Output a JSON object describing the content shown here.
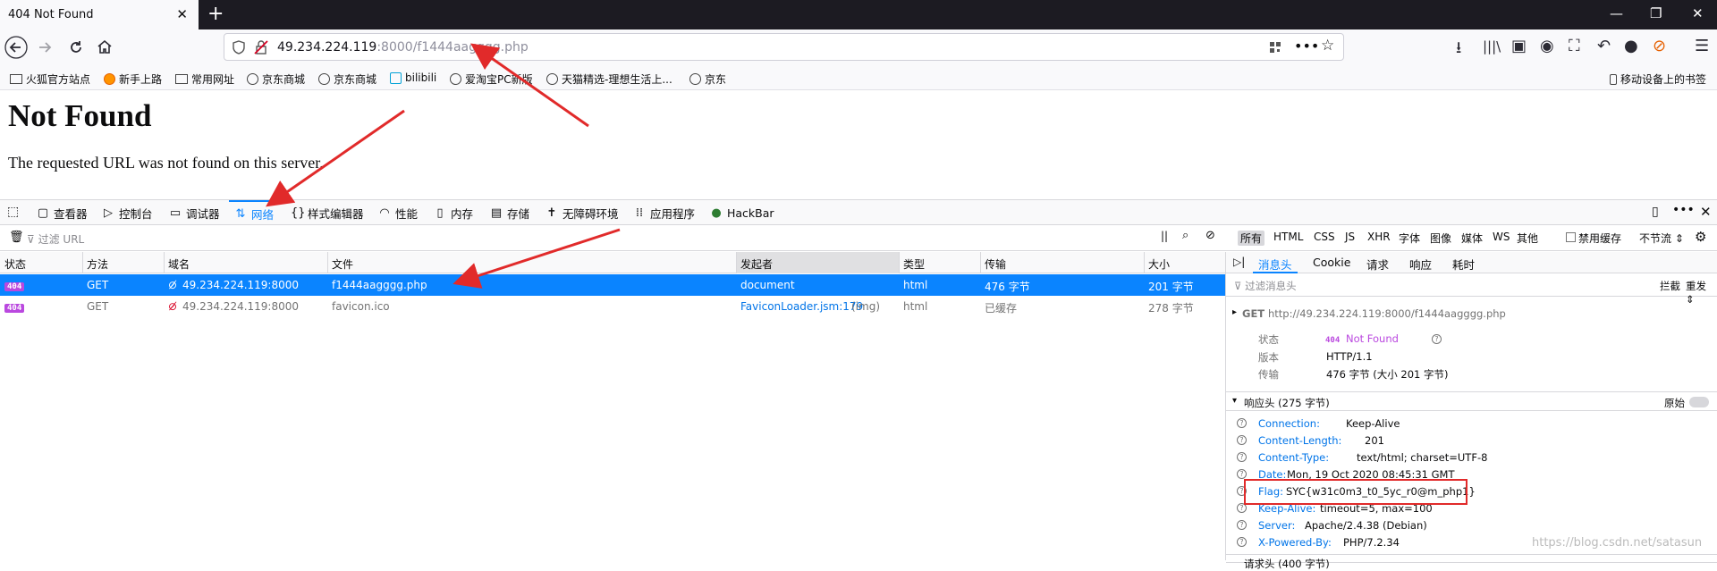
{
  "tab": {
    "title": "404 Not Found",
    "close": "✕",
    "new": "+"
  },
  "url": {
    "host": "49.234.224.119",
    "rest": ":8000/f1444aagggg.php"
  },
  "bookmarks": [
    {
      "label": "火狐官方站点",
      "icon": "folder-icon"
    },
    {
      "label": "新手上路",
      "icon": "firefox-icon"
    },
    {
      "label": "常用网址",
      "icon": "folder-icon"
    },
    {
      "label": "京东商城",
      "icon": "globe-icon"
    },
    {
      "label": "京东商城",
      "icon": "globe-icon"
    },
    {
      "label": "bilibili",
      "icon": "bilibili-icon"
    },
    {
      "label": "爱淘宝PC新版",
      "icon": "globe-icon"
    },
    {
      "label": "天猫精选-理想生活上...",
      "icon": "globe-icon"
    },
    {
      "label": "京东",
      "icon": "globe-icon"
    }
  ],
  "mobile_bookmarks": "移动设备上的书签",
  "page": {
    "title": "Not Found",
    "message": "The requested URL was not found on this server."
  },
  "devtools": {
    "tabs": [
      {
        "label": "查看器",
        "icon": "inspector-icon"
      },
      {
        "label": "控制台",
        "icon": "console-icon"
      },
      {
        "label": "调试器",
        "icon": "debugger-icon"
      },
      {
        "label": "网络",
        "icon": "network-icon"
      },
      {
        "label": "样式编辑器",
        "icon": "style-editor-icon"
      },
      {
        "label": "性能",
        "icon": "performance-icon"
      },
      {
        "label": "内存",
        "icon": "memory-icon"
      },
      {
        "label": "存储",
        "icon": "storage-icon"
      },
      {
        "label": "无障碍环境",
        "icon": "accessibility-icon"
      },
      {
        "label": "应用程序",
        "icon": "application-icon"
      },
      {
        "label": "HackBar",
        "icon": "hackbar-icon"
      }
    ],
    "active_tab": "网络"
  },
  "network": {
    "filter_placeholder": "过滤 URL",
    "types": [
      "所有",
      "HTML",
      "CSS",
      "JS",
      "XHR",
      "字体",
      "图像",
      "媒体",
      "WS",
      "其他"
    ],
    "disable_cache": "禁用缓存",
    "throttle": "不节流 ⇕",
    "columns": [
      "状态",
      "方法",
      "域名",
      "文件",
      "发起者",
      "类型",
      "传输",
      "大小"
    ],
    "rows": [
      {
        "status": "404",
        "method": "GET",
        "domain": "49.234.224.119:8000",
        "file": "f1444aagggg.php",
        "initiator": "document",
        "initiator_extra": "",
        "type": "html",
        "transfer": "476 字节",
        "size": "201 字节"
      },
      {
        "status": "404",
        "method": "GET",
        "domain": "49.234.224.119:8000",
        "file": "favicon.ico",
        "initiator": "FaviconLoader.jsm:179",
        "initiator_extra": "(img)",
        "type": "html",
        "transfer": "已缓存",
        "size": "278 字节"
      }
    ]
  },
  "details": {
    "tabs": [
      "消息头",
      "Cookie",
      "请求",
      "响应",
      "耗时"
    ],
    "filter_placeholder": "过滤消息头",
    "block": "拦截",
    "resend": "重发 ⇕",
    "request_line": "GET",
    "request_url": "http://49.234.224.119:8000/f1444aagggg.php",
    "summary": [
      {
        "key": "状态",
        "value": "Not Found",
        "badge": "404"
      },
      {
        "key": "版本",
        "value": "HTTP/1.1"
      },
      {
        "key": "传输",
        "value": "476 字节 (大小 201 字节)"
      }
    ],
    "response_section": "响应头 (275 字节)",
    "raw": "原始",
    "response_headers": [
      {
        "name": "Connection:",
        "value": "Keep-Alive"
      },
      {
        "name": "Content-Length:",
        "value": "201"
      },
      {
        "name": "Content-Type:",
        "value": "text/html; charset=UTF-8"
      },
      {
        "name": "Date:",
        "value": "Mon, 19 Oct 2020 08:45:31 GMT"
      },
      {
        "name": "Flag:",
        "value": "SYC{w31c0m3_t0_5yc_r0@m_php1}"
      },
      {
        "name": "Keep-Alive:",
        "value": "timeout=5, max=100"
      },
      {
        "name": "Server:",
        "value": "Apache/2.4.38 (Debian)"
      },
      {
        "name": "X-Powered-By:",
        "value": "PHP/7.2.34"
      }
    ],
    "request_section": "请求头 (400 字节)"
  },
  "watermark": "https://blog.csdn.net/satasun",
  "colors": {
    "accent": "#0a84ff",
    "selected_row": "#0a84ff",
    "badge": "#ba48df",
    "annotation": "#e12a2a"
  }
}
